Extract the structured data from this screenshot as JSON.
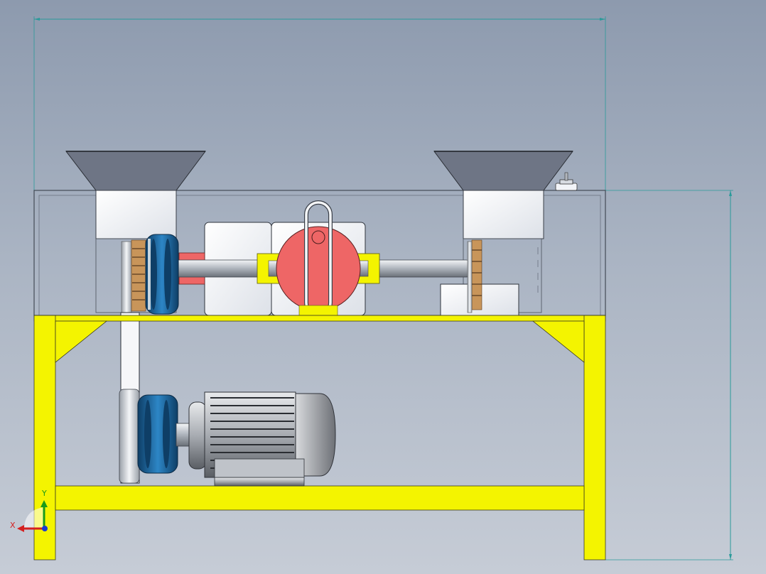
{
  "viewport": {
    "background_top": "#8d9aae",
    "background_bottom": "#c6ccd6"
  },
  "colors": {
    "frame": "#f4f400",
    "frame_edge": "#3a3a20",
    "dimension": "#2a9a9a",
    "hopper": "#6e7585",
    "housing": "#f2f4f8",
    "pulley": "#1f6fa8",
    "eccentric": "#ee6666",
    "bearing_block": "#f4f400",
    "blade": "#c8955a"
  },
  "parts": [
    "frame",
    "cabinet",
    "left-hopper",
    "right-hopper",
    "drive-shaft",
    "eccentric-disc",
    "connecting-link",
    "driven-pulley",
    "belt",
    "motor",
    "motor-pulley"
  ],
  "triad": {
    "x_label": "X",
    "y_label": "Y",
    "x_color": "#d42020",
    "y_color": "#1a9a1a",
    "z_color": "#1a3ad4"
  }
}
